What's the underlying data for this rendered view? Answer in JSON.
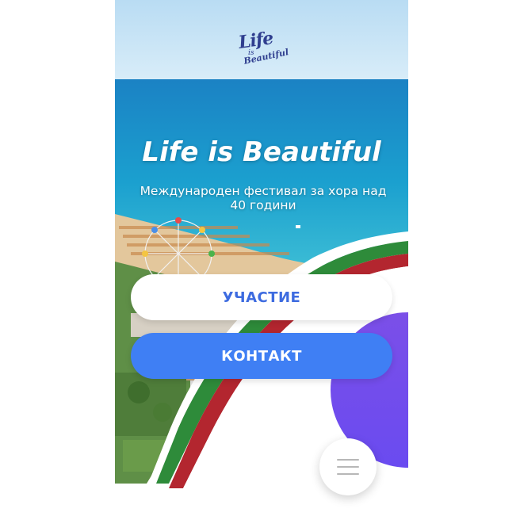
{
  "logo": {
    "line1": "Life",
    "line2": "is",
    "line3": "Beautiful"
  },
  "hero": {
    "title": "Life is Beautiful",
    "subtitle": "Международен фестивал за хора над 40 години"
  },
  "buttons": {
    "participation_label": "УЧАСТИЕ",
    "contact_label": "КОНТАКТ"
  },
  "menu": {
    "icon": "hamburger-menu-icon"
  },
  "colors": {
    "primary_blue": "#3f7ff4",
    "participation_text": "#3d6be0",
    "logo_navy": "#2f3e8f",
    "decor_purple": "#7a52e6",
    "flag_green": "#2e8b3a",
    "flag_red": "#b3262f"
  }
}
